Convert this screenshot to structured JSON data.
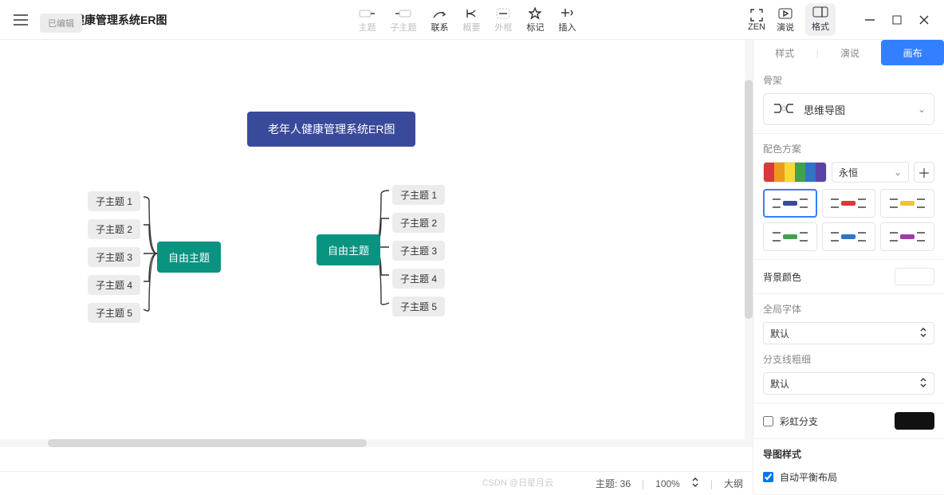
{
  "header": {
    "title": "老年人健康管理系统ER图",
    "subtitle": "已编辑",
    "toolbar": [
      {
        "id": "topic",
        "label": "主题",
        "active": false
      },
      {
        "id": "subtopic",
        "label": "子主题",
        "active": false
      },
      {
        "id": "relation",
        "label": "联系",
        "active": true
      },
      {
        "id": "summary",
        "label": "概要",
        "active": false
      },
      {
        "id": "boundary",
        "label": "外框",
        "active": false
      },
      {
        "id": "marker",
        "label": "标记",
        "active": true
      },
      {
        "id": "insert",
        "label": "插入",
        "active": true
      }
    ],
    "right_tools": [
      {
        "id": "zen",
        "label": "ZEN"
      },
      {
        "id": "present",
        "label": "演说"
      },
      {
        "id": "format",
        "label": "格式"
      }
    ]
  },
  "mindmap": {
    "central": "老年人健康管理系统ER图",
    "float1": {
      "label": "自由主题",
      "subs": [
        "子主题 1",
        "子主题 2",
        "子主题 3",
        "子主题 4",
        "子主题 5"
      ]
    },
    "float2": {
      "label": "自由主题",
      "subs": [
        "子主题 1",
        "子主题 2",
        "子主题 3",
        "子主题 4",
        "子主题 5"
      ]
    }
  },
  "statusbar": {
    "topics": "主题: 36",
    "zoom": "100%",
    "outline": "大纲"
  },
  "panel": {
    "tabs": {
      "style": "样式",
      "present": "演说",
      "canvas": "画布"
    },
    "selected_tab": "canvas",
    "skeleton_label": "骨架",
    "skeleton_value": "思维导图",
    "colors_label": "配色方案",
    "color_scheme": "永恒",
    "scheme_colors": [
      "#d93838",
      "#eb9a1e",
      "#f7d93a",
      "#3fa24e",
      "#2f74c5",
      "#5a42a6"
    ],
    "bg_label": "背景颜色",
    "bg_value": "#ffffff",
    "font_label": "全局字体",
    "font_value": "默认",
    "branch_label": "分支线粗细",
    "branch_value": "默认",
    "rainbow_label": "彩虹分支",
    "rainbow_checked": false,
    "mapstyle_label": "导图样式",
    "auto_balance_label": "自动平衡布局",
    "auto_balance_checked": true,
    "thumb_colors": [
      "#3a4a9b",
      "#d93838",
      "#f0c23a",
      "#3fa24e",
      "#2f74c5",
      "#a13aa6"
    ]
  },
  "watermark": "CSDN @日星月云"
}
